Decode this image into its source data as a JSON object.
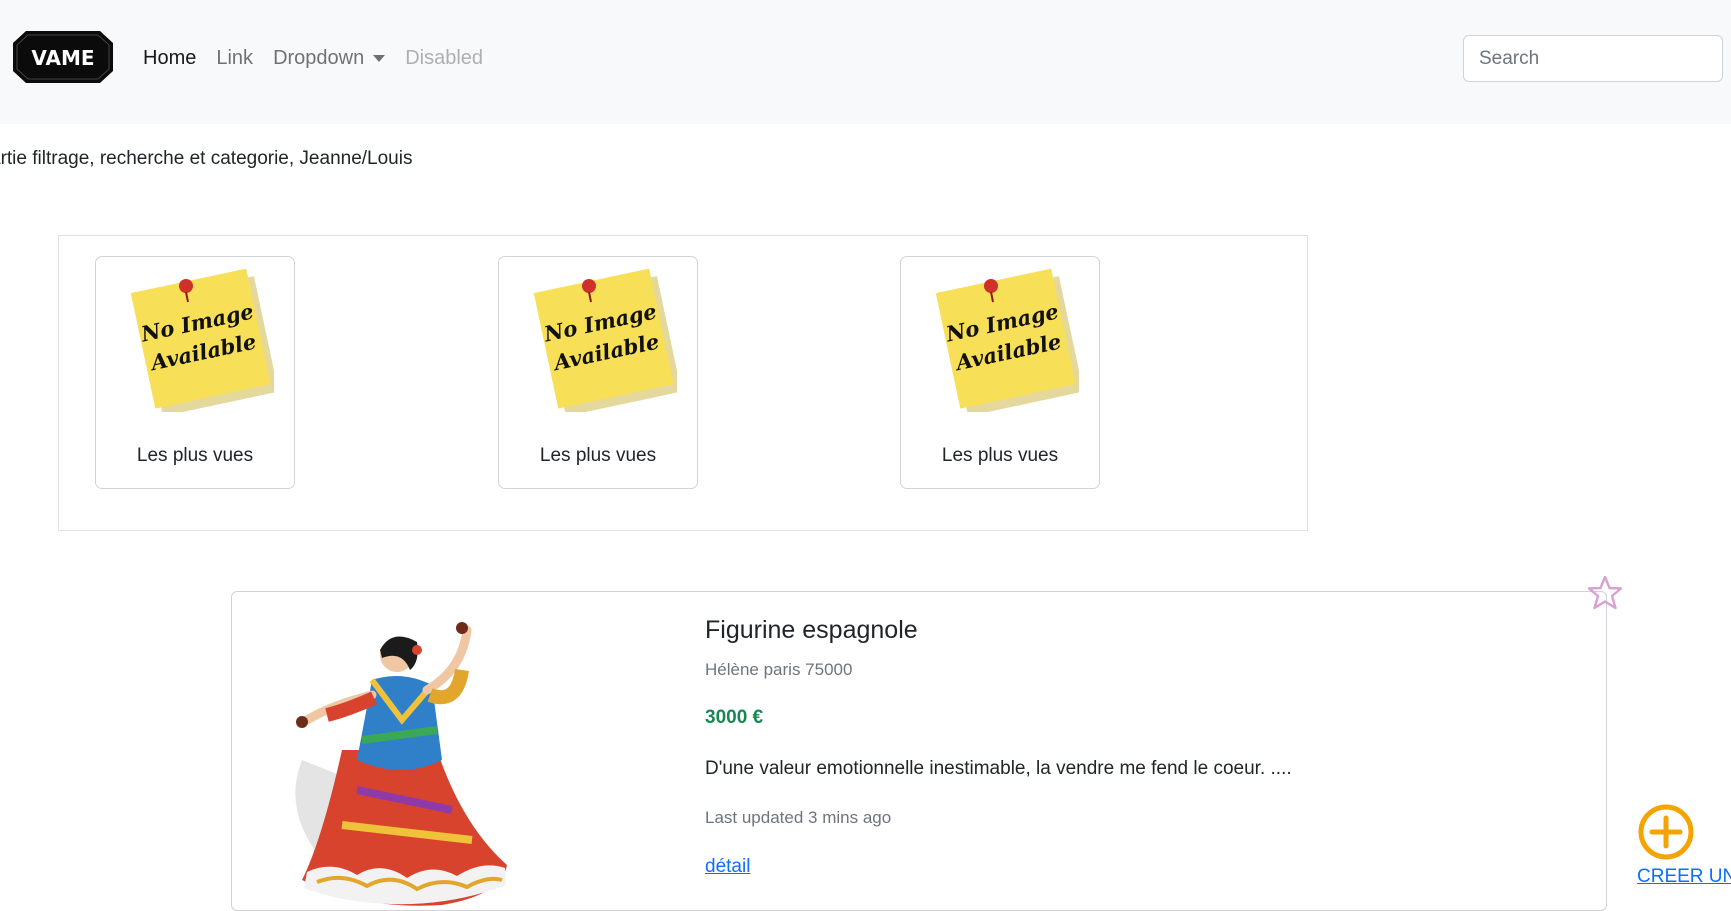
{
  "navbar": {
    "logo_text": "VAME",
    "links": [
      {
        "label": "Home",
        "state": "active"
      },
      {
        "label": "Link",
        "state": "normal"
      },
      {
        "label": "Dropdown",
        "state": "dropdown"
      },
      {
        "label": "Disabled",
        "state": "disabled"
      }
    ],
    "search_placeholder": "Search"
  },
  "filter_section": {
    "text": "artie filtrage, recherche et categorie, Jeanne/Louis"
  },
  "top_cards": [
    {
      "note_line1": "No Image",
      "note_line2": "Available",
      "label": "Les plus vues"
    },
    {
      "note_line1": "No Image",
      "note_line2": "Available",
      "label": "Les plus vues"
    },
    {
      "note_line1": "No Image",
      "note_line2": "Available",
      "label": "Les plus vues"
    }
  ],
  "product": {
    "title": "Figurine espagnole",
    "location": "Hélène paris 75000",
    "price": "3000 €",
    "description": "D'une valeur emotionnelle inestimable, la vendre me fend le coeur. ....",
    "updated": "Last updated 3 mins ago",
    "detail_link": "détail",
    "favorite_icon": "star-outline-icon"
  },
  "create": {
    "icon": "plus-circle-icon",
    "label": "CREER UNI"
  },
  "colors": {
    "navbar_bg": "#f8f9fa",
    "price_green": "#198754",
    "link_blue": "#0d6efd",
    "star_pink": "#d9a0d3",
    "add_orange": "#f5a300",
    "note_yellow": "#f7df57"
  }
}
